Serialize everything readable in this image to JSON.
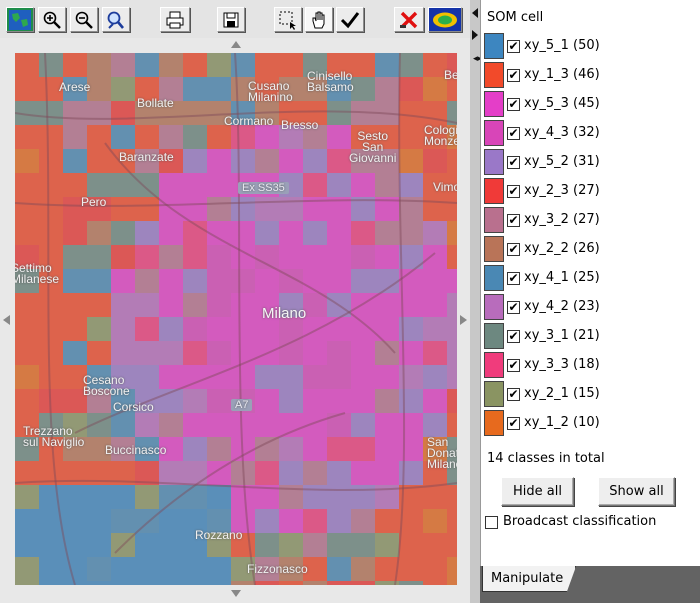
{
  "toolbar": {
    "buttons": [
      {
        "name": "full-extent-icon",
        "glyph": "⊕"
      },
      {
        "name": "zoom-in-icon",
        "glyph": "+"
      },
      {
        "name": "zoom-out-icon",
        "glyph": "−"
      },
      {
        "name": "find-icon",
        "glyph": "?"
      },
      {
        "name": "print-icon",
        "glyph": "⎙"
      },
      {
        "name": "save-icon",
        "glyph": "💾"
      },
      {
        "name": "rectangle-select-icon",
        "glyph": "⬚"
      },
      {
        "name": "pan-hand-icon",
        "glyph": "✋"
      },
      {
        "name": "apply-check-icon",
        "glyph": "✔"
      },
      {
        "name": "remove-x-icon",
        "glyph": "✘"
      },
      {
        "name": "map-layer-icon",
        "glyph": "◉"
      }
    ]
  },
  "map": {
    "places": {
      "arese": "Arese",
      "bollate": "Bollate",
      "cusano": "Cusano\nMilanino",
      "cinisello": "Cinisello\nBalsamo",
      "cormano": "Cormano",
      "bresso": "Bresso",
      "sesto": "Sesto\nSan\nGiovanni",
      "cologno": "Cologi\nMonze",
      "baranzate": "Baranzate",
      "pero": "Pero",
      "vimo": "Vimo",
      "settimo": "Settimo\nMilanese",
      "milano": "Milano",
      "cesano": "Cesano\nBoscone",
      "corsico": "Corsico",
      "trezzano": "Trezzano\nsul Naviglio",
      "buccinasco": "Buccinasco",
      "sandonato": "San\nDonato\nMilanes",
      "rozzano": "Rozzano",
      "fizzonasco": "Fizzonasco",
      "road1": "Ex SS35",
      "road2": "A7",
      "bernate": "Bernate"
    }
  },
  "legend": {
    "title": "SOM cell",
    "items": [
      {
        "label": "xy_5_1 (50)",
        "color": "#3d86c0",
        "checked": "✔"
      },
      {
        "label": "xy_1_3 (46)",
        "color": "#f24a2a",
        "checked": "✔"
      },
      {
        "label": "xy_5_3 (45)",
        "color": "#e43ec8",
        "checked": "✔"
      },
      {
        "label": "xy_4_3 (32)",
        "color": "#d845b8",
        "checked": "✔"
      },
      {
        "label": "xy_5_2 (31)",
        "color": "#9a78c8",
        "checked": "✔"
      },
      {
        "label": "xy_2_3 (27)",
        "color": "#f03a38",
        "checked": "✔"
      },
      {
        "label": "xy_3_2 (27)",
        "color": "#b9708e",
        "checked": "✔"
      },
      {
        "label": "xy_2_2 (26)",
        "color": "#b97458",
        "checked": "✔"
      },
      {
        "label": "xy_4_1 (25)",
        "color": "#4a88b4",
        "checked": "✔"
      },
      {
        "label": "xy_4_2 (23)",
        "color": "#b86cbc",
        "checked": "✔"
      },
      {
        "label": "xy_3_1 (21)",
        "color": "#6d8880",
        "checked": "✔"
      },
      {
        "label": "xy_3_3 (18)",
        "color": "#f03c7c",
        "checked": "✔"
      },
      {
        "label": "xy_2_1 (15)",
        "color": "#8a9462",
        "checked": "✔"
      },
      {
        "label": "xy_1_2 (10)",
        "color": "#e76a1e",
        "checked": "✔"
      }
    ],
    "total_text": "14 classes in total",
    "hide_all": "Hide all",
    "show_all": "Show all",
    "broadcast_label": "Broadcast classification"
  },
  "tabs": {
    "manipulate": "Manipulate"
  }
}
